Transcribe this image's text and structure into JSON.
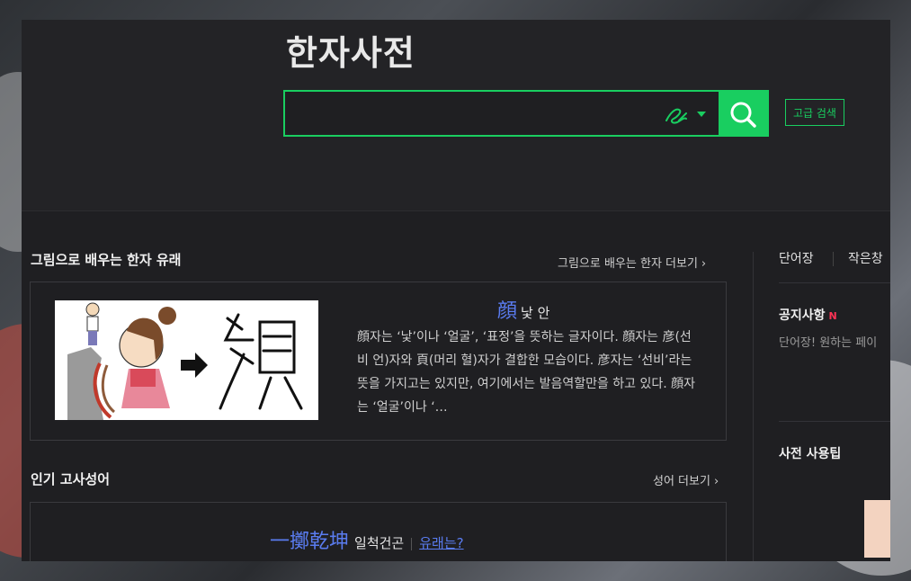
{
  "header": {
    "logo": "한자사전",
    "search": {
      "value": "",
      "placeholder": ""
    },
    "advanced_label": "고급 검색"
  },
  "hanja_origin": {
    "title": "그림으로 배우는 한자 유래",
    "more_label": "그림으로 배우는 한자 더보기",
    "char": "顔",
    "reading": "낯 안",
    "description": "顔자는 ‘낯’이나 ‘얼굴’, ‘표정’을 뜻하는 글자이다. 顔자는 彦(선비 언)자와 頁(머리 혈)자가 결합한 모습이다. 彦자는 ‘선비’라는 뜻을 가지고는 있지만, 여기에서는 발음역할만을 하고 있다. 顔자는 ‘얼굴’이나 ‘…"
  },
  "idioms": {
    "title": "인기 고사성어",
    "more_label": "성어 더보기",
    "hanja": "一擲乾坤",
    "reading": "일척건곤",
    "link_label": "유래는?"
  },
  "sidebar": {
    "tab_wordbook": "단어장",
    "tab_small": "작은창",
    "notice_title": "공지사항",
    "notice_badge": "N",
    "notice_text": "단어장! 원하는 페이",
    "tips_title": "사전 사용팁"
  },
  "colors": {
    "accent": "#19ce60",
    "link": "#5a7cf0",
    "badge": "#ff3355"
  },
  "icons": [
    "handwriting-icon",
    "chevron-down-icon",
    "search-icon",
    "chevron-right-icon"
  ]
}
